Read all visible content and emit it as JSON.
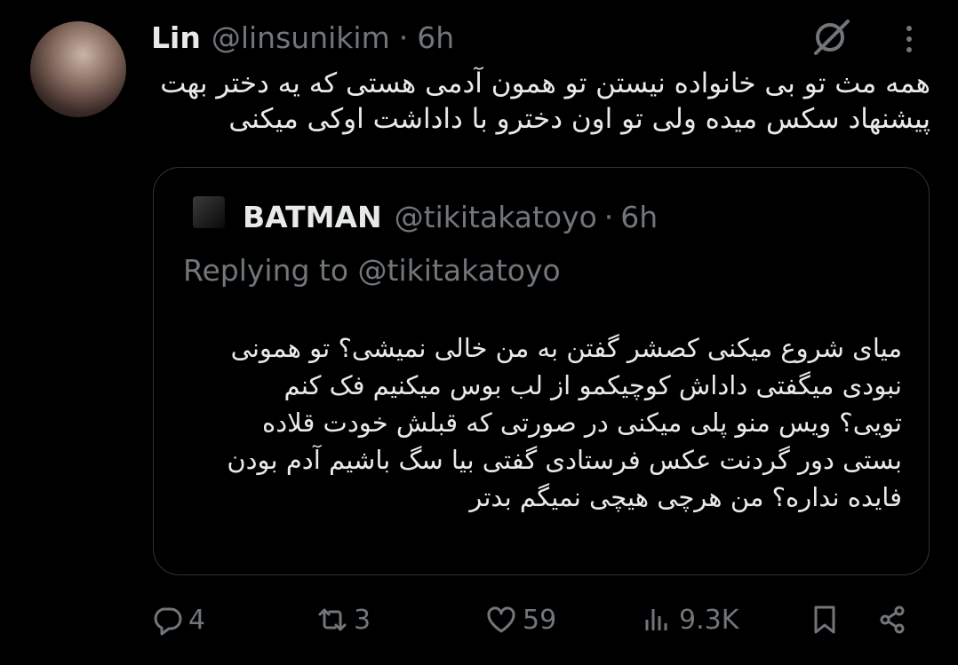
{
  "tweet": {
    "author_name": "Lin",
    "handle": "@linsunikim",
    "separator": "·",
    "time": "6h",
    "text": "همه مث تو بی خانواده نیستن تو همون آدمی هستی که یه دختر بهت\nپیشنهاد سکس میده ولی تو اون دخترو با داداشت اوکی میکنی"
  },
  "quote": {
    "author_name": "BATMAN",
    "handle": "@tikitakatoyo",
    "separator": "·",
    "time": "6h",
    "replying_to": "Replying to @tikitakatoyo",
    "text": "میای شروع میکنی کصشر گفتن به من خالی نمیشی؟ تو همونی\nنبودی میگفتی داداش کوچیکمو از لب بوس میکنیم فک کنم\nتویی؟ ویس منو پلی میکنی در صورتی که قبلش خودت قلاده\nبستی دور گردنت عکس فرستادی گفتی بیا سگ باشیم آدم بودن\nفایده نداره؟ من هرچی هیچی نمیگم بدتر"
  },
  "actions": {
    "replies": "4",
    "retweets": "3",
    "likes": "59",
    "views": "9.3K"
  },
  "icons": {
    "grok": "grok-icon",
    "more": "more-options-icon",
    "reply": "reply-icon",
    "retweet": "retweet-icon",
    "like": "heart-icon",
    "views": "views-icon",
    "bookmark": "bookmark-icon",
    "share": "share-icon"
  },
  "colors": {
    "background": "#000000",
    "text": "#e7e9ea",
    "muted": "#71767b",
    "border": "#2f3336"
  }
}
